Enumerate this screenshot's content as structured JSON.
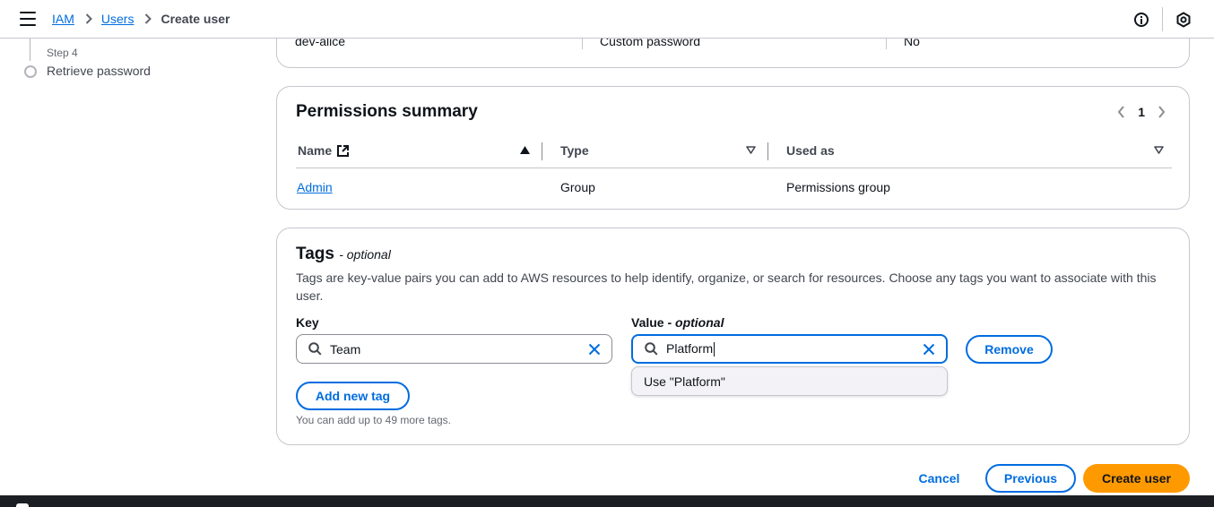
{
  "header": {
    "breadcrumb": {
      "iam": "IAM",
      "users": "Users",
      "current": "Create user"
    },
    "icons": [
      "menu-icon",
      "info-icon",
      "settings-icon"
    ]
  },
  "steps": {
    "step_label": "Step 4",
    "step_title": "Retrieve password"
  },
  "details": {
    "user_name": "dev-alice",
    "password_type": "Custom password",
    "require_reset": "No"
  },
  "permissions": {
    "title": "Permissions summary",
    "page": "1",
    "columns": [
      "Name",
      "Type",
      "Used as"
    ],
    "rows": [
      {
        "name": "Admin",
        "type": "Group",
        "used_as": "Permissions group"
      }
    ]
  },
  "tags": {
    "title": "Tags",
    "optional": "- optional",
    "description": "Tags are key-value pairs you can add to AWS resources to help identify, organize, or search for resources. Choose any tags you want to associate with this user.",
    "key_label": "Key",
    "value_label": "Value - ",
    "value_optional": "optional",
    "key_value": "Team",
    "value_value": "Platform",
    "remove_label": "Remove",
    "suggestion": "Use \"Platform\"",
    "add_label": "Add new tag",
    "hint": "You can add up to 49 more tags."
  },
  "actions": {
    "cancel": "Cancel",
    "previous": "Previous",
    "create": "Create user"
  },
  "colors": {
    "link": "#006ce0",
    "primary_button": "#ff9900",
    "border": "#c6c6cd"
  }
}
